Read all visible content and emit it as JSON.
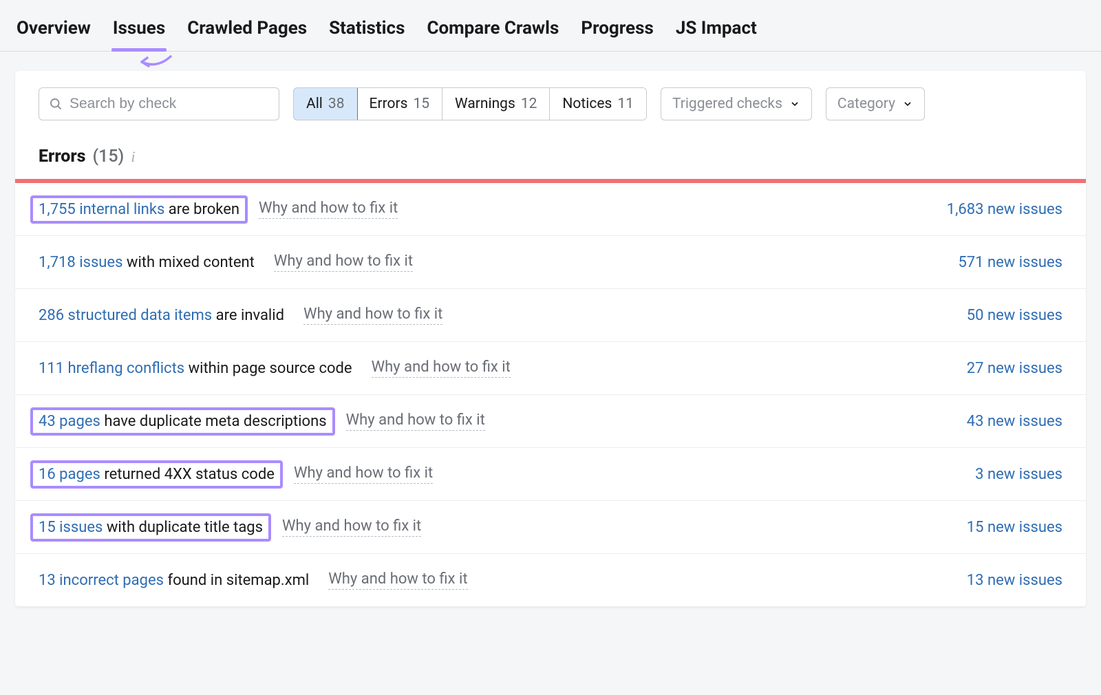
{
  "tabs": [
    {
      "label": "Overview"
    },
    {
      "label": "Issues",
      "active": true
    },
    {
      "label": "Crawled Pages"
    },
    {
      "label": "Statistics"
    },
    {
      "label": "Compare Crawls"
    },
    {
      "label": "Progress"
    },
    {
      "label": "JS Impact"
    }
  ],
  "search": {
    "placeholder": "Search by check"
  },
  "filters": {
    "segments": [
      {
        "label": "All",
        "count": "38",
        "active": true
      },
      {
        "label": "Errors",
        "count": "15"
      },
      {
        "label": "Warnings",
        "count": "12"
      },
      {
        "label": "Notices",
        "count": "11"
      }
    ],
    "triggered_label": "Triggered checks",
    "category_label": "Category"
  },
  "section": {
    "title": "Errors",
    "count": "(15)"
  },
  "hint_label": "Why and how to fix it",
  "rows": [
    {
      "link": "1,755 internal links",
      "rest": " are broken",
      "new": "1,683 new issues",
      "hl": true
    },
    {
      "link": "1,718 issues",
      "rest": " with mixed content",
      "new": "571 new issues",
      "hl": false
    },
    {
      "link": "286 structured data items",
      "rest": " are invalid",
      "new": "50 new issues",
      "hl": false
    },
    {
      "link": "111 hreflang conflicts",
      "rest": " within page source code",
      "new": "27 new issues",
      "hl": false
    },
    {
      "link": "43 pages",
      "rest": " have duplicate meta descriptions",
      "new": "43 new issues",
      "hl": true
    },
    {
      "link": "16 pages",
      "rest": " returned 4XX status code",
      "new": "3 new issues",
      "hl": true
    },
    {
      "link": "15 issues",
      "rest": " with duplicate title tags",
      "new": "15 new issues",
      "hl": true
    },
    {
      "link": "13 incorrect pages",
      "rest": " found in sitemap.xml",
      "new": "13 new issues",
      "hl": false
    }
  ]
}
